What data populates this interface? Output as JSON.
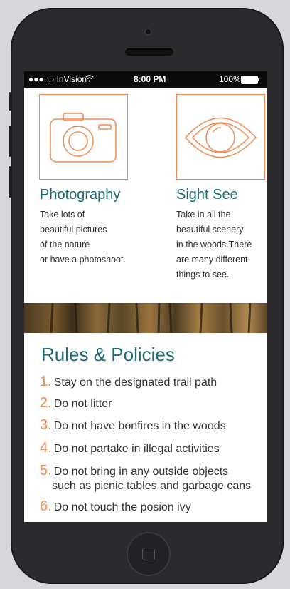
{
  "status_bar": {
    "carrier": "●●●○○ InVision ",
    "time": "8:00 PM",
    "battery": "100%"
  },
  "features": [
    {
      "icon": "camera-icon",
      "title": "Photography",
      "desc": [
        "Take lots of",
        "beautiful pictures",
        "of the nature",
        "or have a photoshoot."
      ]
    },
    {
      "icon": "eye-icon",
      "title": "Sight See",
      "desc": [
        "Take in all the",
        "beautiful scenery",
        "in the woods.There",
        "are many different",
        "things to see."
      ]
    }
  ],
  "rules": {
    "title": "Rules & Policies",
    "items": [
      {
        "num": "1.",
        "text": "Stay on the designated trail path"
      },
      {
        "num": "2.",
        "text": "Do not litter"
      },
      {
        "num": "3.",
        "text": "Do not have bonfires in the woods"
      },
      {
        "num": "4.",
        "text": "Do not partake in illegal activities"
      },
      {
        "num": "5.",
        "text": "Do not bring in any outside objects",
        "text2": "such as picnic tables and garbage cans"
      },
      {
        "num": "6.",
        "text": "Do not touch the posion ivy"
      }
    ]
  },
  "colors": {
    "accent_orange": "#f08a52",
    "title_teal": "#1d6b75"
  }
}
